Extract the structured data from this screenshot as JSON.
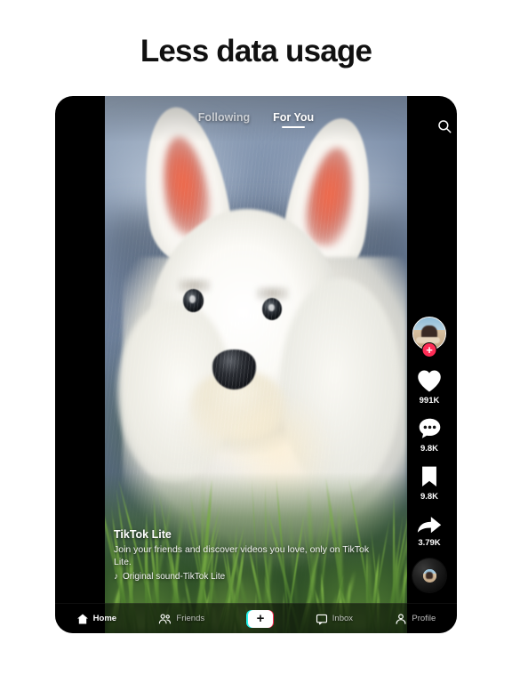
{
  "headline": "Less data usage",
  "app": {
    "top_tabs": [
      {
        "label": "Following",
        "active": false
      },
      {
        "label": "For You",
        "active": true
      }
    ],
    "search_icon": "search-icon",
    "rail": {
      "avatar_icon": "avatar",
      "follow_badge": "+",
      "actions": [
        {
          "icon": "heart-icon",
          "count": "991K"
        },
        {
          "icon": "comment-icon",
          "count": "9.8K"
        },
        {
          "icon": "bookmark-icon",
          "count": "9.8K"
        },
        {
          "icon": "share-icon",
          "count": "3.79K"
        }
      ],
      "music_disc_icon": "music-disc-icon"
    },
    "caption": {
      "username": "TikTok Lite",
      "description": "Join your friends and discover videos you love, only on TikTok Lite.",
      "music_note_icon": "music-note-icon",
      "music": "Original sound-TikTok Lite"
    },
    "bottom_nav": [
      {
        "label": "Home",
        "icon": "home-icon",
        "active": true
      },
      {
        "label": "Friends",
        "icon": "friends-icon",
        "active": false
      },
      {
        "label": "",
        "icon": "create-plus-icon",
        "active": false
      },
      {
        "label": "Inbox",
        "icon": "inbox-icon",
        "active": false
      },
      {
        "label": "Profile",
        "icon": "profile-icon",
        "active": false
      }
    ],
    "create_plus_label": "+"
  },
  "colors": {
    "page_bg": "#ffffff",
    "headline": "#111111",
    "frame": "#000000",
    "accent_pink": "#fe2c55",
    "accent_cyan": "#25f4ee",
    "text_on_video": "#ffffff"
  }
}
